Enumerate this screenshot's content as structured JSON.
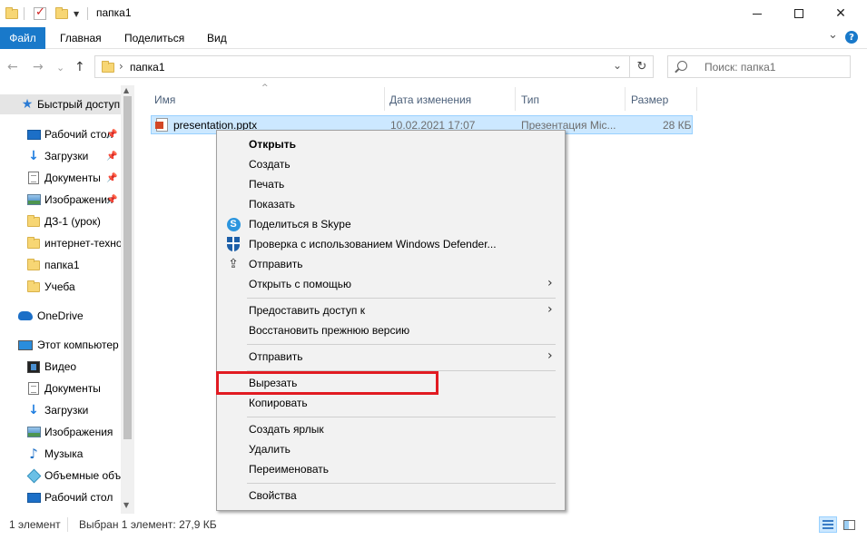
{
  "window": {
    "title": "папка1",
    "minimize": "minimize",
    "maximize": "maximize",
    "close": "✕"
  },
  "ribbon": {
    "file_tab": "Файл",
    "tabs": [
      "Главная",
      "Поделиться",
      "Вид"
    ],
    "collapse_glyph": "⌄",
    "help_glyph": "?"
  },
  "address": {
    "back": "←",
    "forward": "→",
    "recent": "⌄",
    "up": "↑",
    "chevron": "›",
    "path": "папка1",
    "dropdown": "⌄",
    "refresh": "↻",
    "search_placeholder": "Поиск: папка1"
  },
  "navpane": {
    "items": [
      {
        "label": "Быстрый доступ",
        "icon": "star-icon",
        "pinned": false
      },
      {
        "label": "Рабочий стол",
        "icon": "desktop-icon",
        "pinned": true
      },
      {
        "label": "Загрузки",
        "icon": "download-icon",
        "pinned": true
      },
      {
        "label": "Документы",
        "icon": "documents-icon",
        "pinned": true
      },
      {
        "label": "Изображения",
        "icon": "pictures-icon",
        "pinned": true
      },
      {
        "label": "ДЗ-1 (урок)",
        "icon": "folder-icon",
        "pinned": false
      },
      {
        "label": "интернет-технологии",
        "icon": "folder-icon",
        "pinned": false
      },
      {
        "label": "папка1",
        "icon": "folder-icon",
        "pinned": false
      },
      {
        "label": "Учеба",
        "icon": "folder-icon",
        "pinned": false
      },
      {
        "label": "OneDrive",
        "icon": "onedrive-icon",
        "pinned": false
      },
      {
        "label": "Этот компьютер",
        "icon": "computer-icon",
        "pinned": false
      },
      {
        "label": "Видео",
        "icon": "video-icon",
        "pinned": false
      },
      {
        "label": "Документы",
        "icon": "documents-icon",
        "pinned": false
      },
      {
        "label": "Загрузки",
        "icon": "download-icon",
        "pinned": false
      },
      {
        "label": "Изображения",
        "icon": "pictures-icon",
        "pinned": false
      },
      {
        "label": "Музыка",
        "icon": "music-icon",
        "pinned": false
      },
      {
        "label": "Объемные объекты",
        "icon": "3d-objects-icon",
        "pinned": false
      },
      {
        "label": "Рабочий стол",
        "icon": "desktop-icon",
        "pinned": false
      }
    ],
    "pin_glyph": "📌"
  },
  "filelist": {
    "columns": [
      "Имя",
      "Дата изменения",
      "Тип",
      "Размер"
    ],
    "sort_glyph": "^",
    "rows": [
      {
        "name": "presentation.pptx",
        "date": "10.02.2021 17:07",
        "type": "Презентация Mic...",
        "size": "28 КБ"
      }
    ]
  },
  "context_menu": {
    "open": "Открыть",
    "create": "Создать",
    "print": "Печать",
    "show": "Показать",
    "skype": "Поделиться в Skype",
    "defender": "Проверка с использованием Windows Defender...",
    "send": "Отправить",
    "open_with": "Открыть с помощью",
    "give_access": "Предоставить доступ к",
    "restore": "Восстановить прежнюю версию",
    "send_to": "Отправить",
    "cut": "Вырезать",
    "copy": "Копировать",
    "shortcut": "Создать ярлык",
    "delete": "Удалить",
    "rename": "Переименовать",
    "properties": "Свойства",
    "submenu_glyph": "›",
    "skype_glyph": "S",
    "share_glyph": "⇪"
  },
  "status": {
    "count": "1 элемент",
    "selection": "Выбран 1 элемент: 27,9 КБ"
  },
  "colors": {
    "accent": "#1979ca",
    "selection": "#cce8ff",
    "highlight_frame": "#e11b22"
  }
}
